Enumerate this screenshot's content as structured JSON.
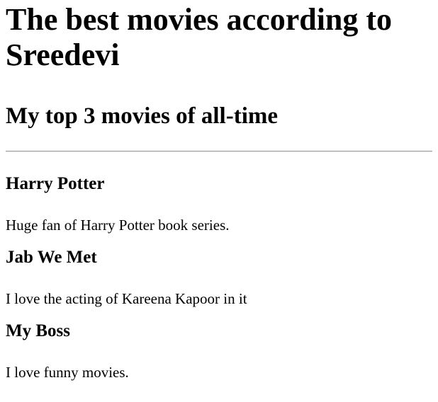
{
  "page": {
    "title": "The best movies according to Sreedevi",
    "subtitle": "My top 3 movies of all-time"
  },
  "movies": [
    {
      "title": "Harry Potter",
      "description": "Huge fan of Harry Potter book series."
    },
    {
      "title": "Jab We Met",
      "description": "I love the acting of Kareena Kapoor in it"
    },
    {
      "title": "My Boss",
      "description": "I love funny movies."
    }
  ]
}
